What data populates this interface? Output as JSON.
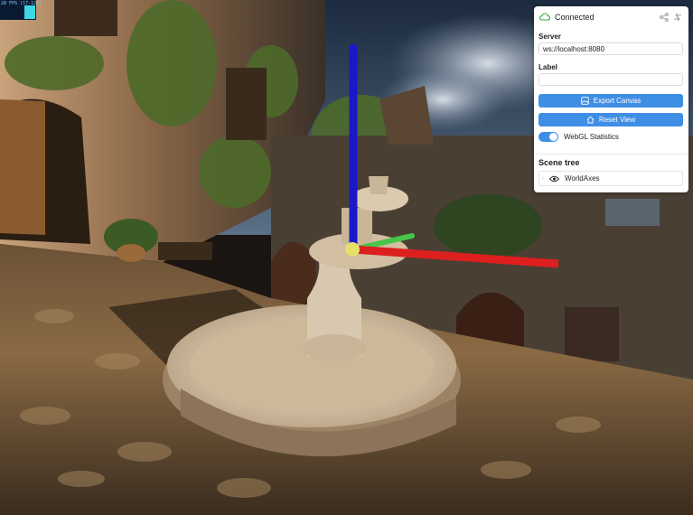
{
  "fps_overlay": {
    "text": "28 FPS (17-121)"
  },
  "connection": {
    "status": "Connected"
  },
  "server": {
    "label": "Server",
    "value": "ws://localhost:8080"
  },
  "label_field": {
    "label": "Label",
    "value": ""
  },
  "buttons": {
    "export": "Export Canvas",
    "reset": "Reset View"
  },
  "webgl": {
    "label": "WebGL Statistics",
    "enabled": true
  },
  "scene_tree": {
    "title": "Scene tree",
    "items": [
      {
        "name": "WorldAxes"
      }
    ]
  },
  "axes_colors": {
    "x": "#dd1f1f",
    "y": "#46c64a",
    "z": "#1a18c8"
  },
  "accent": "#3f8ee6"
}
